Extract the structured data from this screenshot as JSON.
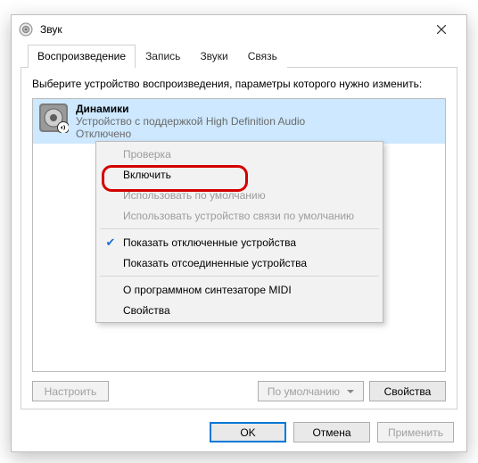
{
  "window": {
    "title": "Звук"
  },
  "tabs": [
    {
      "label": "Воспроизведение",
      "active": true
    },
    {
      "label": "Запись",
      "active": false
    },
    {
      "label": "Звуки",
      "active": false
    },
    {
      "label": "Связь",
      "active": false
    }
  ],
  "instruction": "Выберите устройство воспроизведения, параметры которого нужно изменить:",
  "device": {
    "name": "Динамики",
    "driver": "Устройство с поддержкой High Definition Audio",
    "status": "Отключено"
  },
  "context_menu": [
    {
      "label": "Проверка",
      "enabled": false
    },
    {
      "label": "Включить",
      "enabled": true,
      "highlight": true
    },
    {
      "label": "Использовать по умолчанию",
      "enabled": false
    },
    {
      "label": "Использовать устройство связи по умолчанию",
      "enabled": false
    },
    {
      "sep": true
    },
    {
      "label": "Показать отключенные устройства",
      "enabled": true,
      "checked": true
    },
    {
      "label": "Показать отсоединенные устройства",
      "enabled": true
    },
    {
      "sep": true
    },
    {
      "label": "О программном синтезаторе MIDI",
      "enabled": true
    },
    {
      "label": "Свойства",
      "enabled": true
    }
  ],
  "panel_buttons": {
    "configure": "Настроить",
    "set_default": "По умолчанию",
    "properties": "Свойства"
  },
  "dialog_buttons": {
    "ok": "OK",
    "cancel": "Отмена",
    "apply": "Применить"
  }
}
